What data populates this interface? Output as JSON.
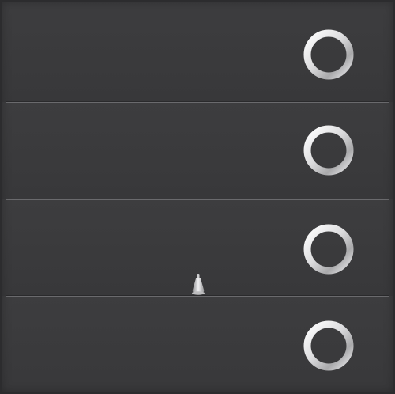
{
  "door": {
    "panel_count": 4,
    "colors": {
      "panel": "#3b3b3d",
      "seam_dark": "#2a2a2c",
      "seam_light": "#6a6a6d",
      "ring_light": "#f2f2f2",
      "ring_dark": "#a9a9ab"
    },
    "icons": {
      "ring": "ring-icon",
      "handle": "handle-icon"
    }
  }
}
